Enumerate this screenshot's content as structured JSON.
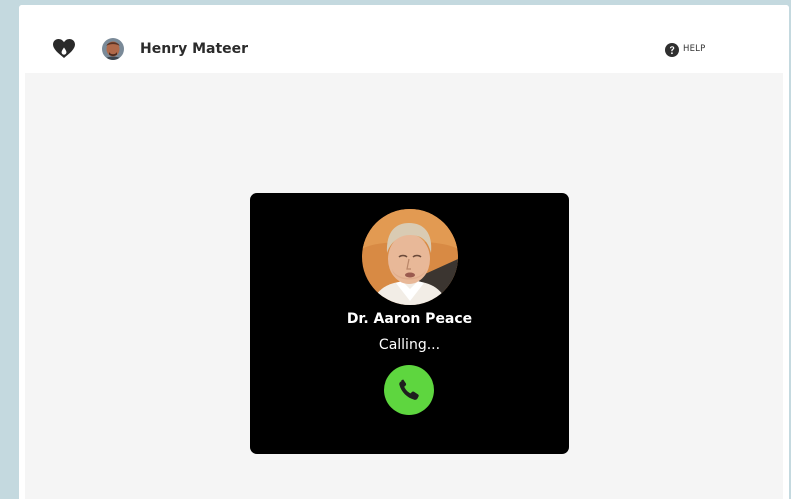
{
  "header": {
    "logo_icon": "heart-drop-icon",
    "user_name": "Henry Mateer",
    "help_label": "HELP",
    "help_icon": "question-circle-icon"
  },
  "call": {
    "callee_name": "Dr. Aaron Peace",
    "status": "Calling...",
    "button_icon": "phone-icon",
    "button_color": "#5ed63f"
  },
  "colors": {
    "page_background": "#c4d9df",
    "content_background": "#f5f5f5",
    "card_background": "#000000"
  }
}
